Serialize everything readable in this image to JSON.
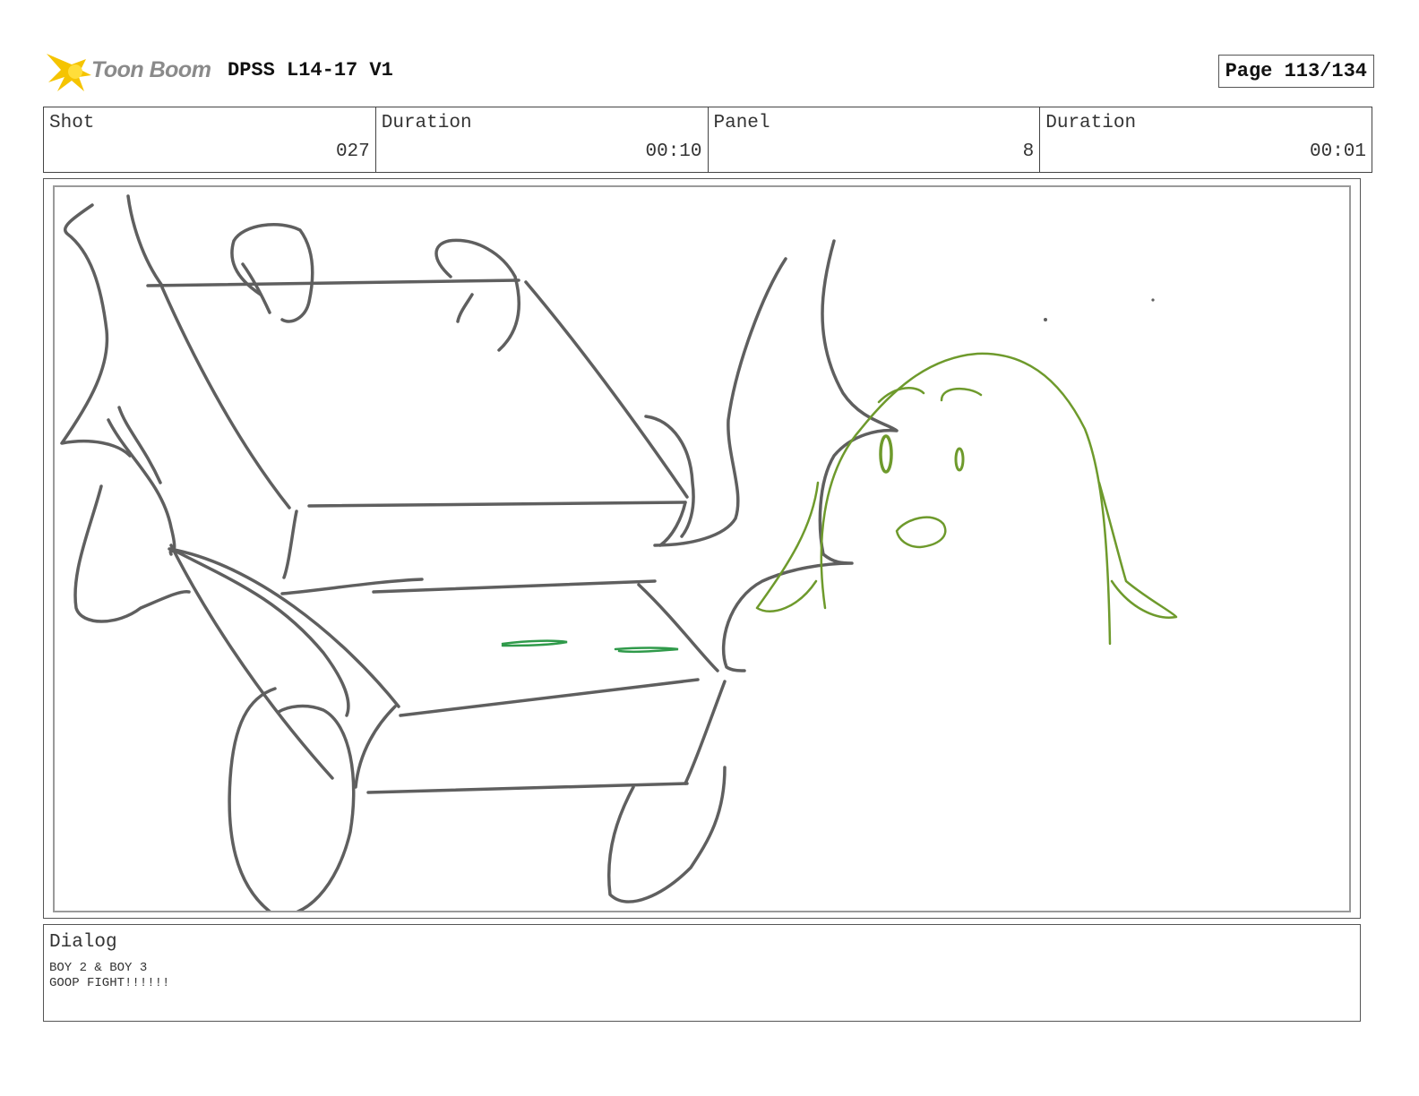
{
  "header": {
    "logo_text": "Toon Boom",
    "title": "DPSS L14-17 V1",
    "page_label": "Page 113/134"
  },
  "info": {
    "shot_label": "Shot",
    "shot_value": "027",
    "shot_duration_label": "Duration",
    "shot_duration_value": "00:10",
    "panel_label": "Panel",
    "panel_value": "8",
    "panel_duration_label": "Duration",
    "panel_duration_value": "00:01"
  },
  "dialog": {
    "label": "Dialog",
    "lines": [
      "BOY 2 & BOY 3",
      "GOOP FIGHT!!!!!!"
    ]
  },
  "colors": {
    "sketch_gray": "#5f5f5f",
    "goop_green": "#6e9a2c",
    "splash_green": "#2f9a4a",
    "logo_yellow": "#f5c400"
  }
}
